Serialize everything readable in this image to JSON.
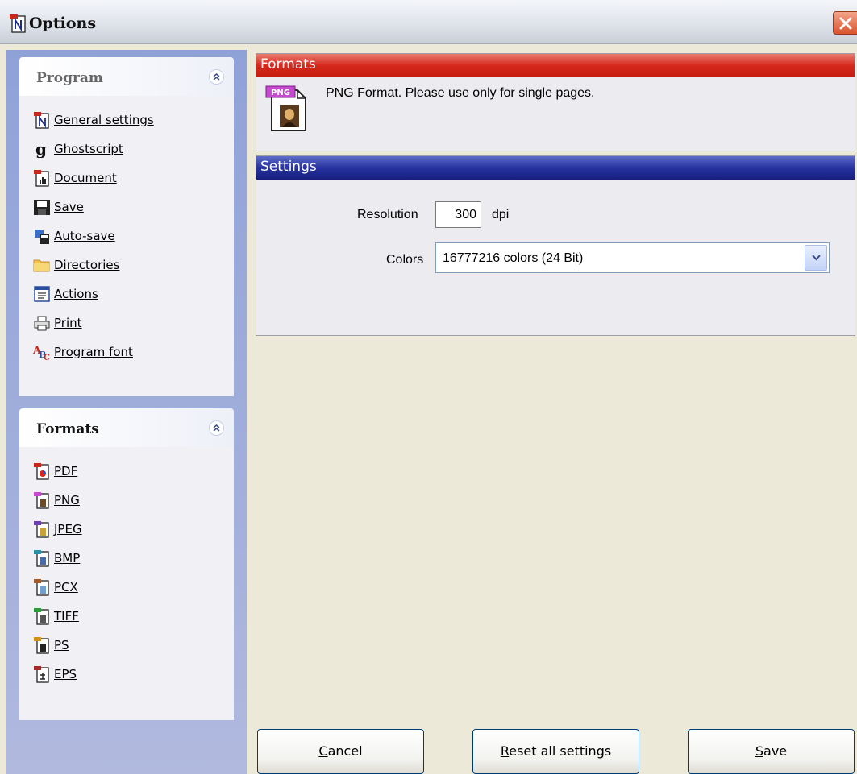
{
  "window": {
    "title": "Options"
  },
  "program_group": {
    "title": "Program",
    "items": [
      {
        "label": "General settings",
        "icon": "general-settings-icon"
      },
      {
        "label": "Ghostscript",
        "icon": "ghostscript-icon"
      },
      {
        "label": "Document",
        "icon": "document-icon"
      },
      {
        "label": "Save",
        "icon": "save-icon"
      },
      {
        "label": "Auto-save",
        "icon": "auto-save-icon"
      },
      {
        "label": "Directories",
        "icon": "folder-icon"
      },
      {
        "label": "Actions",
        "icon": "actions-icon"
      },
      {
        "label": "Print",
        "icon": "printer-icon"
      },
      {
        "label": "Program font",
        "icon": "font-icon"
      }
    ]
  },
  "formats_group": {
    "title": "Formats",
    "items": [
      {
        "label": "PDF"
      },
      {
        "label": "PNG"
      },
      {
        "label": "JPEG"
      },
      {
        "label": "BMP"
      },
      {
        "label": "PCX"
      },
      {
        "label": "TIFF"
      },
      {
        "label": "PS"
      },
      {
        "label": "EPS"
      }
    ]
  },
  "formats_panel": {
    "header": "Formats",
    "icon_badge": "PNG",
    "description": "PNG Format. Please use only for single pages."
  },
  "settings_panel": {
    "header": "Settings",
    "resolution_label": "Resolution",
    "resolution_value": "300",
    "resolution_unit": "dpi",
    "colors_label": "Colors",
    "colors_value": "16777216 colors (24 Bit)"
  },
  "buttons": {
    "cancel": {
      "mn": "C",
      "rest": "ancel"
    },
    "reset": {
      "mn": "R",
      "rest": "eset all settings"
    },
    "save": {
      "mn": "S",
      "rest": "ave"
    }
  },
  "colors": {
    "formats_header": "#d6281c",
    "settings_header": "#2732a0",
    "pane_background": "#a2afdb"
  }
}
